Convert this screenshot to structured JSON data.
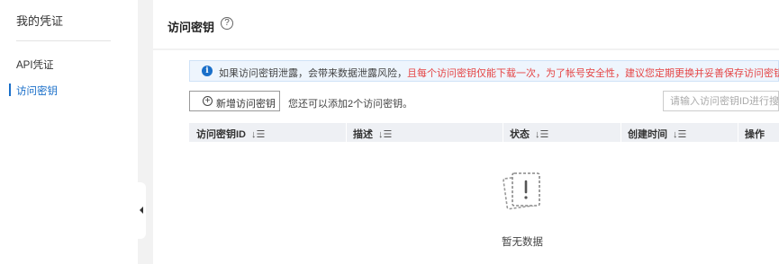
{
  "sidebar": {
    "title": "我的凭证",
    "items": [
      {
        "label": "API凭证"
      },
      {
        "label": "访问密钥"
      }
    ]
  },
  "header": {
    "title": "访问密钥",
    "help_glyph": "?"
  },
  "notice": {
    "icon_glyph": "i",
    "text_normal": "如果访问密钥泄露，会带来数据泄露风险，",
    "text_warning": "且每个访问密钥仅能下载一次，为了帐号安全性，建议您定期更换并妥善保存访问密钥。"
  },
  "toolbar": {
    "add_button_label": "新增访问密钥",
    "add_button_glyph": "+",
    "hint": "您还可以添加2个访问密钥。",
    "search_placeholder": "请输入访问密钥ID进行搜索"
  },
  "table": {
    "columns": [
      {
        "label": "访问密钥ID",
        "sort_glyph": "↓☰"
      },
      {
        "label": "描述",
        "sort_glyph": "↓☰"
      },
      {
        "label": "状态",
        "sort_glyph": "↓☰"
      },
      {
        "label": "创建时间",
        "sort_glyph": "↓☰"
      },
      {
        "label": "操作"
      }
    ],
    "rows": [],
    "empty_text": "暂无数据"
  },
  "colors": {
    "accent": "#1a6fc9",
    "warning": "#e54545",
    "background": "#f2f2f2"
  },
  "icons": {
    "empty_state": "empty-document-icon",
    "info": "info-icon",
    "help": "help-circle-icon",
    "add": "plus-circle-icon",
    "collapse": "collapse-left-icon"
  }
}
